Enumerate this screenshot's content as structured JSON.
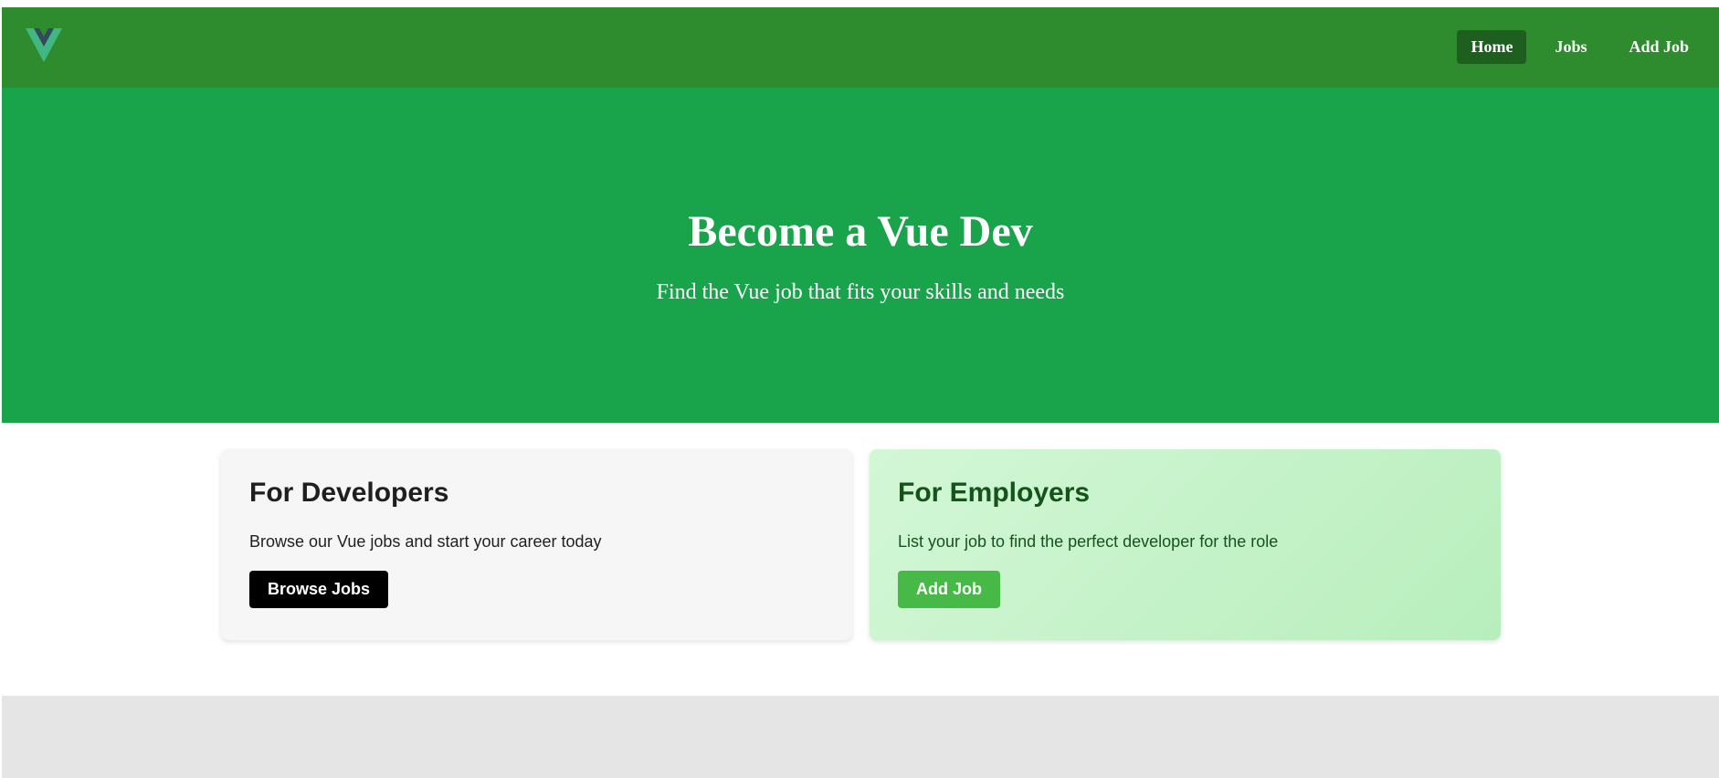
{
  "navbar": {
    "logo_icon": "vue-logo-icon",
    "links": [
      {
        "label": "Home",
        "active": true
      },
      {
        "label": "Jobs",
        "active": false
      },
      {
        "label": "Add Job",
        "active": false
      }
    ]
  },
  "hero": {
    "title": "Become a Vue Dev",
    "subtitle": "Find the Vue job that fits your skills and needs"
  },
  "cards": {
    "developers": {
      "title": "For Developers",
      "text": "Browse our Vue jobs and start your career today",
      "button_label": "Browse Jobs"
    },
    "employers": {
      "title": "For Employers",
      "text": "List your job to find the perfect developer for the role",
      "button_label": "Add Job"
    }
  },
  "colors": {
    "navbar_bg": "#2e8b2e",
    "hero_bg": "#19a34a",
    "nav_active_bg": "#1e5e1e",
    "employer_button": "#46b946",
    "developer_button": "#000000"
  }
}
